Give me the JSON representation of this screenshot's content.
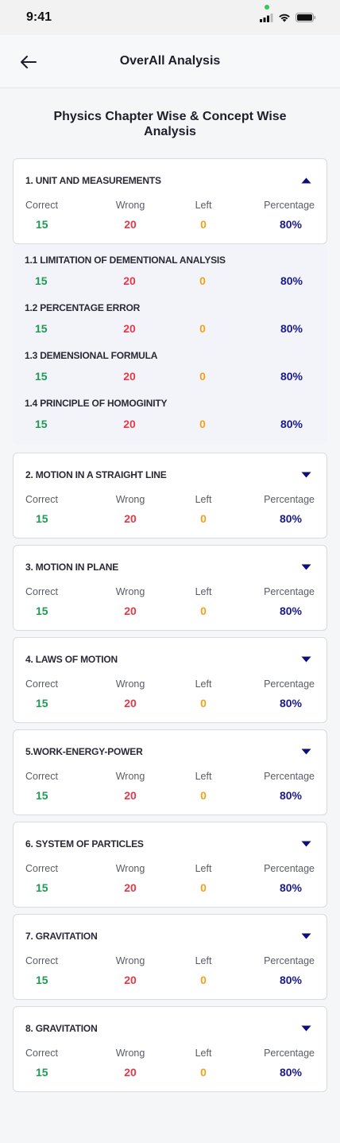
{
  "status": {
    "time": "9:41"
  },
  "header": {
    "title": "OverAll Analysis"
  },
  "heading": "Physics Chapter Wise & Concept Wise Analysis",
  "col_labels": {
    "correct": "Correct",
    "wrong": "Wrong",
    "left": "Left",
    "percentage": "Percentage"
  },
  "colors": {
    "correct": "#1f9a55",
    "wrong": "#e5394a",
    "left": "#f0a21c",
    "percentage": "#1a1a8c"
  },
  "chapters": [
    {
      "title": "1. UNIT AND MEASUREMENTS",
      "correct": "15",
      "wrong": "20",
      "left": "0",
      "percentage": "80%",
      "expanded": true,
      "concepts": [
        {
          "title": "1.1 LIMITATION OF DEMENTIONAL ANALYSIS",
          "correct": "15",
          "wrong": "20",
          "left": "0",
          "percentage": "80%"
        },
        {
          "title": "1.2 PERCENTAGE ERROR",
          "correct": "15",
          "wrong": "20",
          "left": "0",
          "percentage": "80%"
        },
        {
          "title": "1.3 DEMENSIONAL FORMULA",
          "correct": "15",
          "wrong": "20",
          "left": "0",
          "percentage": "80%"
        },
        {
          "title": "1.4 PRINCIPLE OF HOMOGINITY",
          "correct": "15",
          "wrong": "20",
          "left": "0",
          "percentage": "80%"
        }
      ]
    },
    {
      "title": "2. MOTION IN A STRAIGHT LINE",
      "correct": "15",
      "wrong": "20",
      "left": "0",
      "percentage": "80%",
      "expanded": false
    },
    {
      "title": "3. MOTION IN PLANE",
      "correct": "15",
      "wrong": "20",
      "left": "0",
      "percentage": "80%",
      "expanded": false
    },
    {
      "title": "4. LAWS OF MOTION",
      "correct": "15",
      "wrong": "20",
      "left": "0",
      "percentage": "80%",
      "expanded": false
    },
    {
      "title": "5.WORK-ENERGY-POWER",
      "correct": "15",
      "wrong": "20",
      "left": "0",
      "percentage": "80%",
      "expanded": false
    },
    {
      "title": "6. SYSTEM OF PARTICLES",
      "correct": "15",
      "wrong": "20",
      "left": "0",
      "percentage": "80%",
      "expanded": false
    },
    {
      "title": "7. GRAVITATION",
      "correct": "15",
      "wrong": "20",
      "left": "0",
      "percentage": "80%",
      "expanded": false
    },
    {
      "title": "8. GRAVITATION",
      "correct": "15",
      "wrong": "20",
      "left": "0",
      "percentage": "80%",
      "expanded": false
    }
  ]
}
